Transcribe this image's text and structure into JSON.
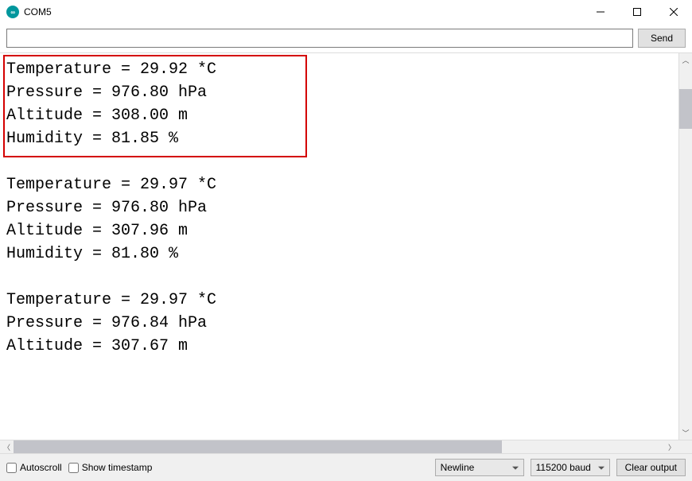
{
  "window": {
    "title": "COM5"
  },
  "input": {
    "value": "",
    "send_label": "Send"
  },
  "output": {
    "lines": [
      "Temperature = 29.92 *C",
      "Pressure = 976.80 hPa",
      "Altitude = 308.00 m",
      "Humidity = 81.85 %",
      "",
      "Temperature = 29.97 *C",
      "Pressure = 976.80 hPa",
      "Altitude = 307.96 m",
      "Humidity = 81.80 %",
      "",
      "Temperature = 29.97 *C",
      "Pressure = 976.84 hPa",
      "Altitude = 307.67 m"
    ]
  },
  "bottom": {
    "autoscroll_label": "Autoscroll",
    "timestamp_label": "Show timestamp",
    "line_ending": "Newline",
    "baud": "115200 baud",
    "clear_label": "Clear output"
  }
}
